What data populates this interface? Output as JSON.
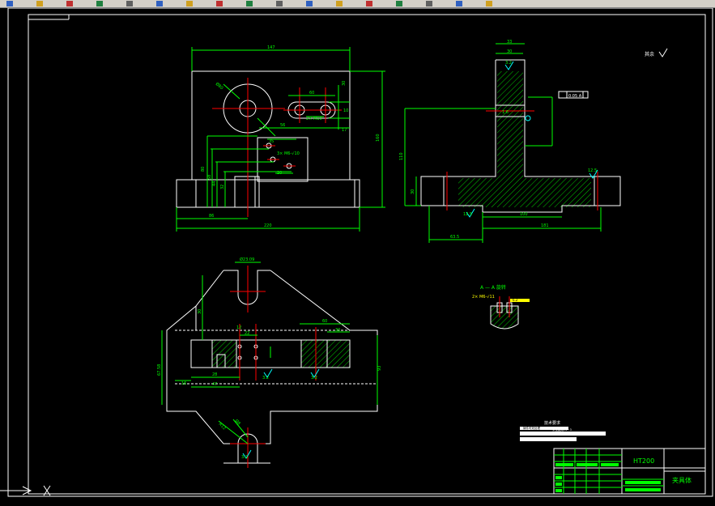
{
  "toolbar": {
    "icons": [
      "new-icon",
      "open-icon",
      "save-icon",
      "print-icon",
      "cut-icon",
      "copy-icon",
      "paste-icon",
      "undo-icon",
      "redo-icon",
      "zoom-icon",
      "pan-icon",
      "layer-icon",
      "properties-icon",
      "match-icon",
      "measure-icon",
      "table-icon",
      "help-icon"
    ]
  },
  "colors": {
    "background": "#000000",
    "outline": "#ffffff",
    "dimension": "#00ff00",
    "centerline": "#ff0000",
    "hatch": "#00ff00",
    "note": "#ffff00",
    "roughness": "#00ffff"
  },
  "front_view": {
    "dims": {
      "overall_width_top": "147",
      "overall_width_bottom": "220",
      "left_offset": "86",
      "height_total": "160",
      "height_80": "80",
      "height_58": "58",
      "height_44": "44",
      "height_32": "32",
      "dim_30": "30",
      "dim_10": "10",
      "dim_17": "17",
      "dim_60": "60",
      "dim_35": "35",
      "dim_20": "20",
      "dim_56": "56",
      "bore": "Ø80",
      "thread_top": "2× M10",
      "thread_mid": "3× M6-√10"
    }
  },
  "side_view": {
    "dims": {
      "top_33": "33",
      "top_30": "30",
      "rough_top": "3.2",
      "rough_side": "1.6",
      "tol_box": "0.05 A",
      "height_110": "110",
      "height_30": "30",
      "rough_bottom": "12.5",
      "rough_base": "12.5",
      "dim_100": "100",
      "dim_181": "181",
      "dim_63": "63.5"
    }
  },
  "top_view": {
    "dims": {
      "slot_width": "Ø23.09",
      "dim_30": "30",
      "dim_60": "60",
      "dim_30b": "30",
      "dim_12": "12",
      "dim_22": "22",
      "dim_28": "28",
      "dim_47": "47",
      "dim_16": "16",
      "dim_67": "67.58",
      "dim_93": "93",
      "rough_1": "3.2",
      "rough_2": "3.2",
      "r_slot": "R12",
      "r_dim": "Ø8",
      "rough_3": "3.2"
    }
  },
  "section": {
    "title": "A — A 旋转",
    "note": "2× M6-√11",
    "rough": "6.2"
  },
  "tech_req": {
    "heading": "技术要求",
    "line1": "铸件时效处理",
    "line2": "未注圆角R2~3"
  },
  "title_block": {
    "material": "HT200",
    "part_name": "夹具体"
  },
  "misc": {
    "top_right_note": "其余",
    "axis_x": "X"
  }
}
